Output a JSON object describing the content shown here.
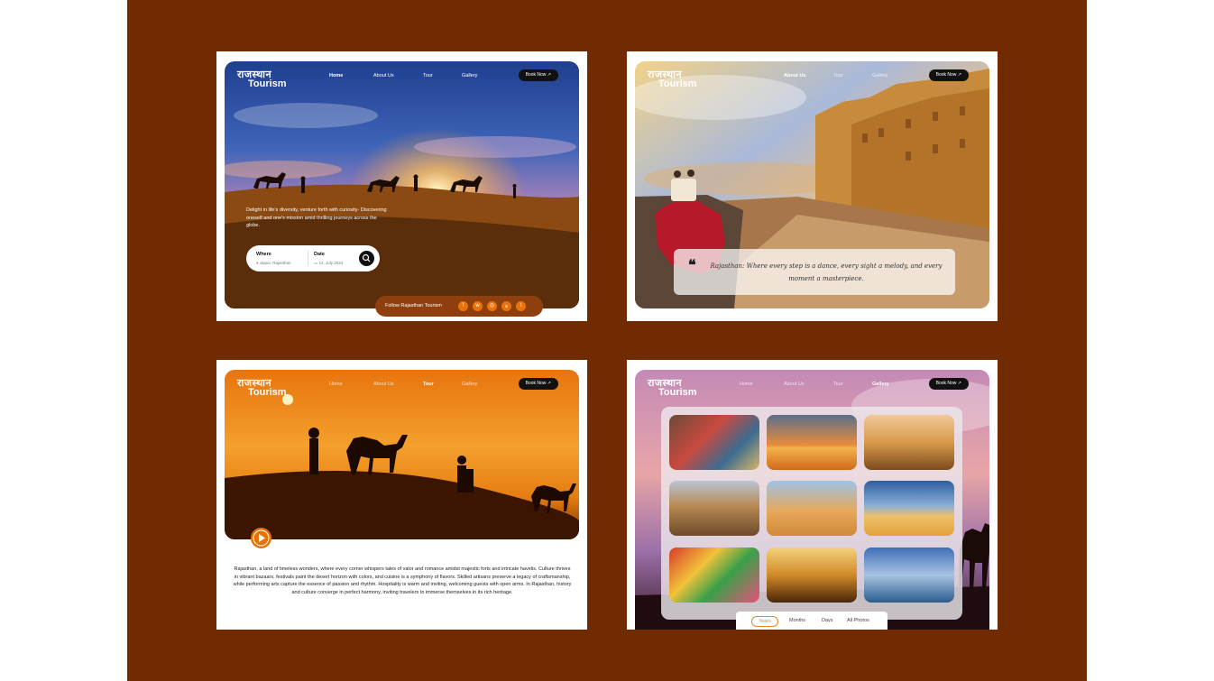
{
  "brand": {
    "hindi": "राजस्थान",
    "english": "Tourism"
  },
  "nav": {
    "home": "Home",
    "about": "About Us",
    "tour": "Tour",
    "gallery": "Gallery",
    "book": "Book Now ↗"
  },
  "home_screen": {
    "tagline": "Delight in life's diversity, venture forth with curiosity- Discovering oneself and one's mission amid thrilling journeys across the globe.",
    "where_label": "Where",
    "where_value": "⌖ Jaipur, Rajasthan",
    "date_label": "Date",
    "date_value": "▭ 12, July 2024",
    "follow_text": "Follow Rajasthan Tourism",
    "social": [
      "f",
      "w",
      "◎",
      "in",
      "t"
    ]
  },
  "about_screen": {
    "quote": "Rajasthan: Where every step is a dance, every sight a melody, and every moment a masterpiece."
  },
  "tour_screen": {
    "description": "Rajasthan, a land of timeless wonders, where every corner whispers tales of valor and romance amidst majestic forts and intricate havelis. Culture thrives in vibrant bazaars, festivals paint the desert horizon with colors, and cuisine is a symphony of flavors. Skilled artisans preserve a legacy of craftsmanship, while performing arts capture the essence of passion and rhythm. Hospitality is warm and inviting, welcoming guests with open arms. In Rajasthan, history and culture converge in perfect harmony, inviting travelers to immerse themselves in its rich heritage."
  },
  "gallery_screen": {
    "tabs": [
      "Years",
      "Months",
      "Days",
      "All Photos"
    ]
  },
  "colors": {
    "background": "#702b02",
    "accent": "#e37306",
    "follow_bar": "#8e3f0d"
  }
}
